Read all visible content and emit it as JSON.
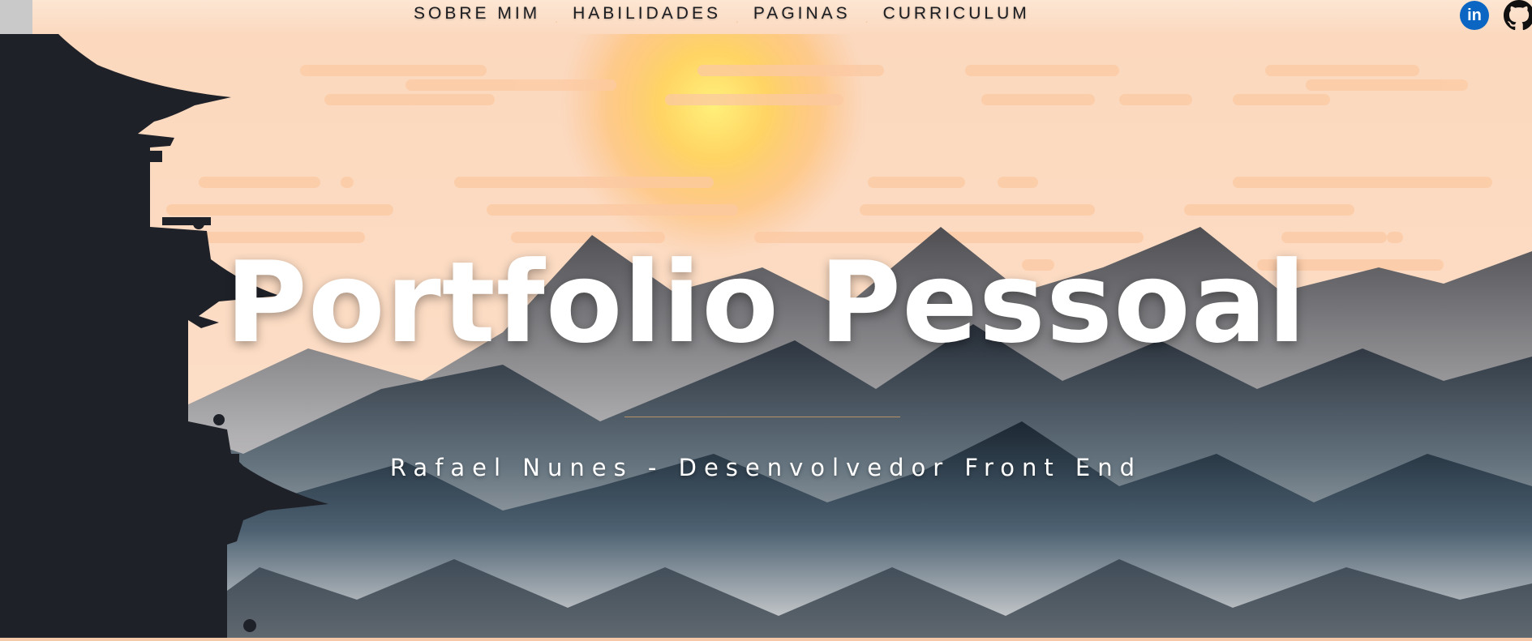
{
  "nav": {
    "items": [
      {
        "label": "SOBRE MIM"
      },
      {
        "label": "HABILIDADES"
      },
      {
        "label": "PAGINAS"
      },
      {
        "label": "CURRICULUM"
      }
    ],
    "separator": "."
  },
  "social": {
    "linkedin": {
      "icon": "linkedin-icon",
      "glyph": "in",
      "color": "#0a66c2"
    },
    "github": {
      "icon": "github-icon"
    }
  },
  "hero": {
    "title": "Portfolio Pessoal",
    "subtitle": "Rafael Nunes - Desenvolvedor Front End"
  },
  "colors": {
    "sky": "#fbd6b9",
    "sun": "#ffd56b",
    "pagoda": "#1f2129",
    "accent_line": "#b79468"
  }
}
